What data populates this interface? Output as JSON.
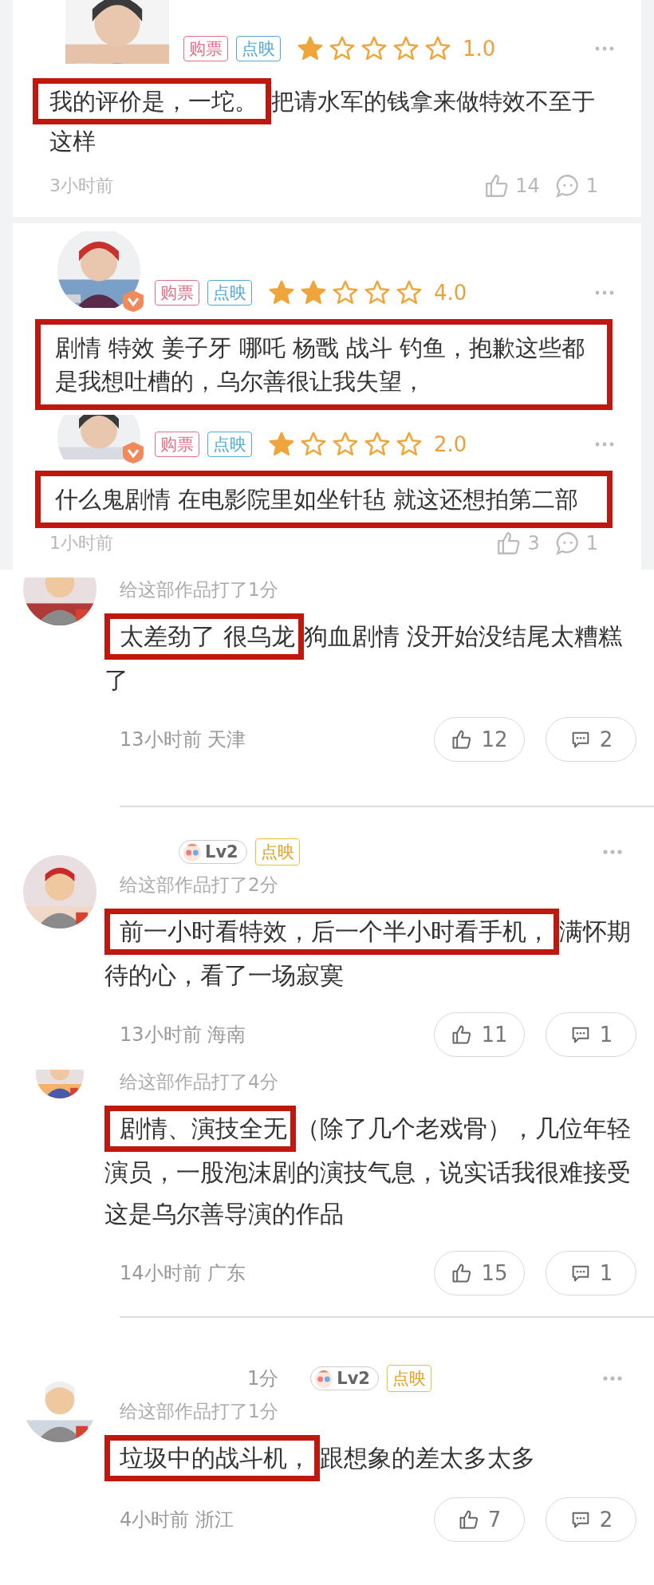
{
  "top_comments": [
    {
      "avatar": {
        "kind": "picture"
      },
      "more_menu": true,
      "tags": [
        {
          "label": "购票",
          "color": "#e0708a"
        },
        {
          "label": "点映",
          "color": "#52a9d6"
        }
      ],
      "stars": 1,
      "rating": "1.0",
      "text": {
        "highlight": "我的评价是，一坨。",
        "rest": "把请水军的钱拿来做特效不至于这样"
      },
      "time": "3小时前",
      "likes": "14",
      "replies": "1"
    },
    {
      "avatar": {
        "kind": "picture"
      },
      "verified": true,
      "more_menu": true,
      "tags": [
        {
          "label": "购票",
          "color": "#e0708a"
        },
        {
          "label": "点映",
          "color": "#52a9d6"
        }
      ],
      "stars": 2,
      "rating": "4.0",
      "text": {
        "highlight": "剧情 特效 姜子牙 哪吒 杨戬 战斗 钓鱼，抱歉这些都是我想吐槽的，乌尔善很让我失望，"
      }
    },
    {
      "avatar": {
        "kind": "picture"
      },
      "verified": true,
      "more_menu": true,
      "tags": [
        {
          "label": "购票",
          "color": "#e0708a"
        },
        {
          "label": "点映",
          "color": "#52a9d6"
        }
      ],
      "stars": 1,
      "rating": "2.0",
      "text": {
        "highlight": "什么鬼剧情 在电影院里如坐针毡 就这还想拍第二部"
      },
      "time": "1小时前",
      "likes": "3",
      "replies": "1"
    }
  ],
  "reviews": [
    {
      "avatar": {
        "kind": "picture"
      },
      "score_line": "给这部作品打了1分",
      "text": {
        "highlight": "太差劲了 很乌龙",
        "rest": "狗血剧情 没开始没结尾太糟糕了"
      },
      "meta": "13小时前 天津",
      "likes": "12",
      "replies": "2"
    },
    {
      "avatar": {
        "kind": "picture"
      },
      "more_menu": true,
      "badges": [
        {
          "kind": "level",
          "label": "Lv2"
        },
        {
          "kind": "preview",
          "label": "点映"
        }
      ],
      "score_line": "给这部作品打了2分",
      "text": {
        "highlight": "前一小时看特效，后一个半小时看手机，",
        "rest": "满怀期待的心，看了一场寂寞"
      },
      "meta": "13小时前 海南",
      "likes": "11",
      "replies": "1"
    },
    {
      "avatar": {
        "kind": "picture"
      },
      "score_line": "给这部作品打了4分",
      "text": {
        "highlight": "剧情、演技全无",
        "rest": "（除了几个老戏骨），几位年轻演员，一股泡沫剧的演技气息，说实话我很难接受这是乌尔善导演的作品"
      },
      "meta": "14小时前 广东",
      "likes": "15",
      "replies": "1"
    },
    {
      "avatar": {
        "kind": "picture"
      },
      "more_menu": true,
      "name": "1分",
      "badges": [
        {
          "kind": "level",
          "label": "Lv2"
        },
        {
          "kind": "preview",
          "label": "点映"
        }
      ],
      "score_line": "给这部作品打了1分",
      "text": {
        "highlight": "垃圾中的战斗机，",
        "rest": "跟想象的差太多太多"
      },
      "meta": "4小时前 浙江",
      "likes": "7",
      "replies": "2"
    }
  ]
}
